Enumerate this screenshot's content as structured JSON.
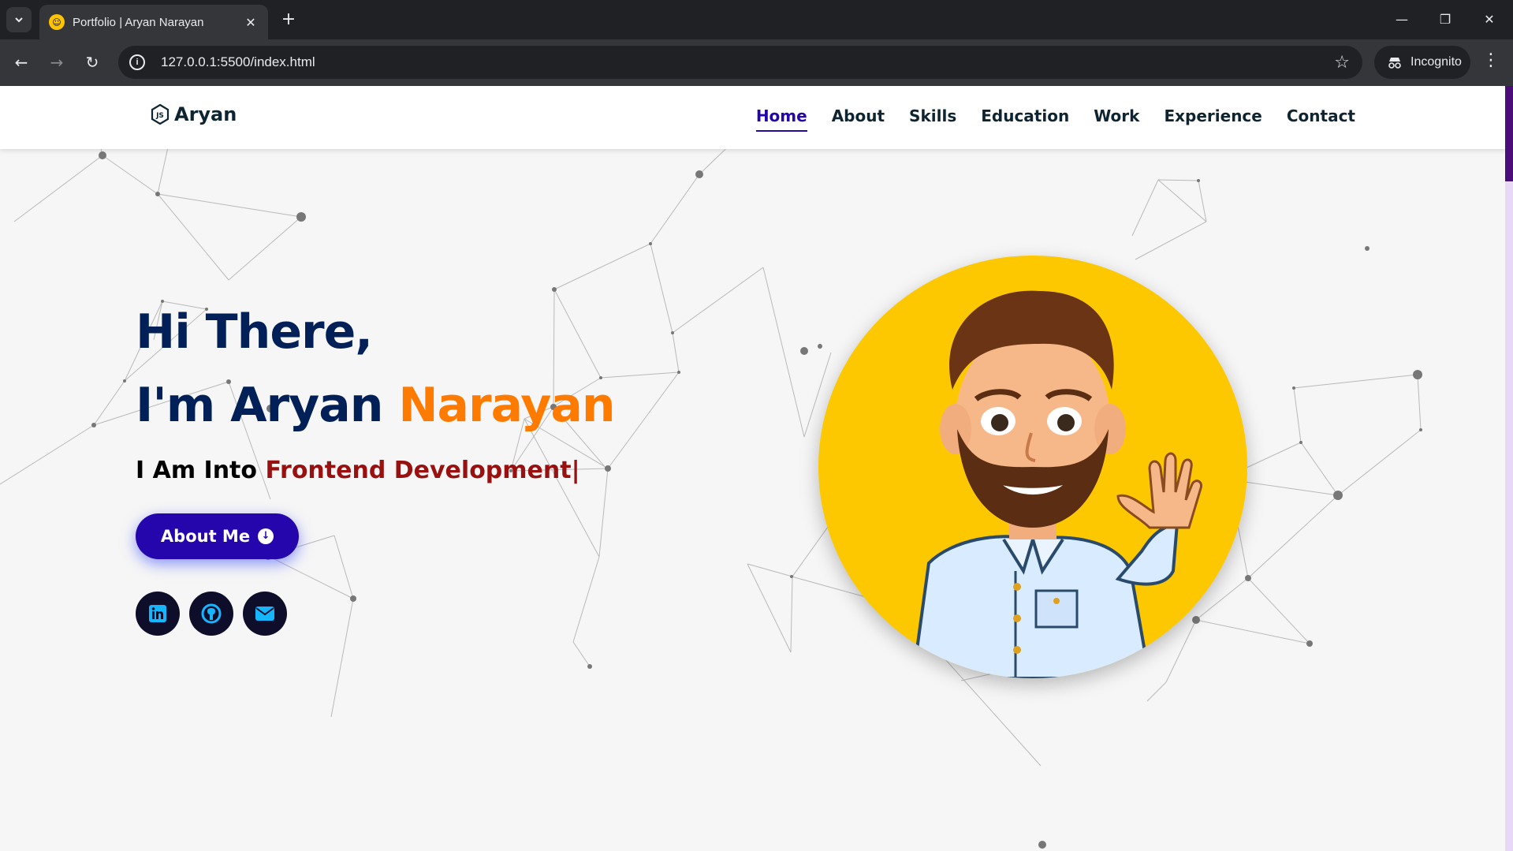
{
  "browser": {
    "tab_title": "Portfolio | Aryan Narayan",
    "url": "127.0.0.1:5500/index.html",
    "incognito_label": "Incognito"
  },
  "site": {
    "logo_text": "Aryan",
    "nav": [
      {
        "label": "Home",
        "active": true
      },
      {
        "label": "About",
        "active": false
      },
      {
        "label": "Skills",
        "active": false
      },
      {
        "label": "Education",
        "active": false
      },
      {
        "label": "Work",
        "active": false
      },
      {
        "label": "Experience",
        "active": false
      },
      {
        "label": "Contact",
        "active": false
      }
    ]
  },
  "hero": {
    "greeting": "Hi There,",
    "intro_prefix": "I'm Aryan ",
    "intro_highlight": "Narayan",
    "typed_prefix": "I Am Into ",
    "typed_text": "Frontend Development",
    "typed_cursor": "|",
    "about_button": "About Me",
    "socials": [
      "linkedin-icon",
      "github-icon",
      "mail-icon"
    ]
  },
  "colors": {
    "primary": "#2506ad",
    "heading": "#002057",
    "orange": "#ff7b00",
    "maroon": "#991010",
    "avatar_bg": "#fec800"
  }
}
